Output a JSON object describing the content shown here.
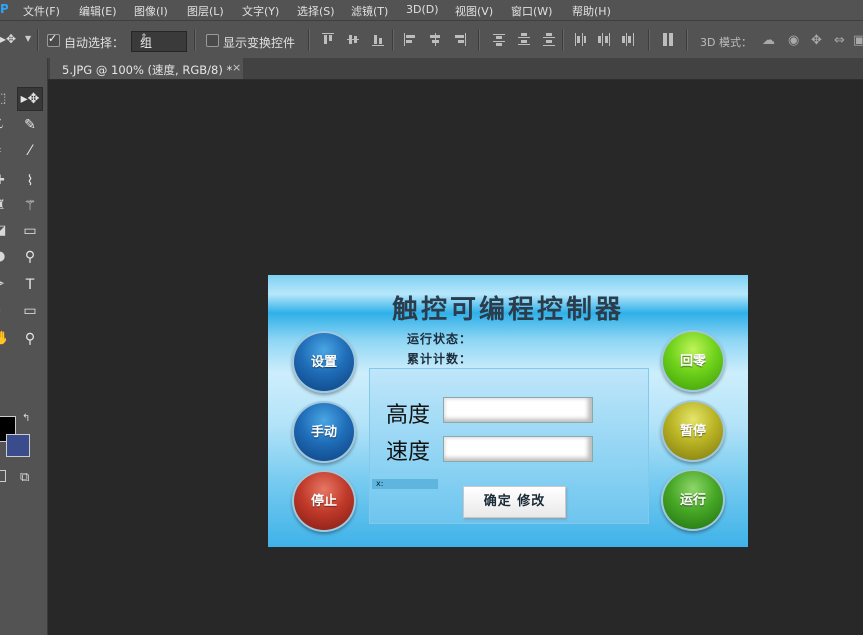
{
  "app": {
    "logo_text": "Ps"
  },
  "menu": [
    "文件(F)",
    "编辑(E)",
    "图像(I)",
    "图层(L)",
    "文字(Y)",
    "选择(S)",
    "滤镜(T)",
    "3D(D)",
    "视图(V)",
    "窗口(W)",
    "帮助(H)"
  ],
  "options_bar": {
    "auto_select_label": "自动选择：",
    "auto_select_checked": true,
    "auto_select_value": "组",
    "show_transform_label": "显示变换控件",
    "show_transform_checked": false,
    "mode_3d_label": "3D 模式："
  },
  "document_tab": {
    "title": "5.JPG @ 100% (速度, RGB/8) *",
    "close": "×"
  },
  "colors": {
    "foreground": "#000000",
    "background": "#3a4c8c",
    "ui_dark": "#535353",
    "canvas": "#282828"
  },
  "hmi": {
    "title": "触控可编程控制器",
    "status_run": "运行状态：",
    "status_count": "累计计数：",
    "field_height_label": "高度",
    "field_speed_label": "速度",
    "field_height_value": "",
    "field_speed_value": "",
    "coord_label": "x:",
    "confirm_label": "确定  修改",
    "left_buttons": [
      "设置",
      "手动",
      "停止"
    ],
    "right_buttons": [
      "回零",
      "暂停",
      "运行"
    ]
  }
}
